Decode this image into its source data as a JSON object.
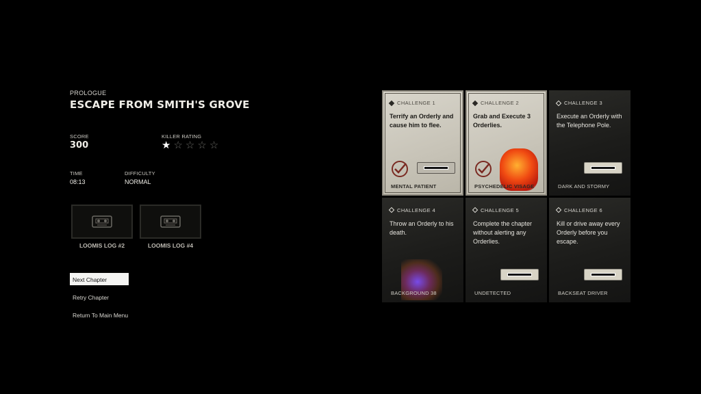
{
  "chapter": {
    "label": "PROLOGUE",
    "title": "ESCAPE FROM SMITH'S GROVE"
  },
  "stats": {
    "score_label": "SCORE",
    "score": "300",
    "rating_label": "KILLER RATING",
    "rating_value": 1,
    "rating_max": 5,
    "time_label": "TIME",
    "time": "08:13",
    "difficulty_label": "DIFFICULTY",
    "difficulty": "NORMAL"
  },
  "logs": [
    {
      "name": "LOOMIS LOG #2",
      "icon": "cassette-icon"
    },
    {
      "name": "LOOMIS LOG #4",
      "icon": "cassette-icon"
    }
  ],
  "menu": [
    {
      "label": "Next Chapter",
      "selected": true
    },
    {
      "label": "Retry Chapter",
      "selected": false
    },
    {
      "label": "Return To Main Menu",
      "selected": false
    }
  ],
  "challenges": [
    {
      "title": "CHALLENGE 1",
      "desc": "Terrify an Orderly and cause him to flee.",
      "reward": "MENTAL PATIENT",
      "completed": true
    },
    {
      "title": "CHALLENGE 2",
      "desc": "Grab and Execute 3 Orderlies.",
      "reward": "PSYCHEDELIC VISAGE",
      "completed": true
    },
    {
      "title": "CHALLENGE 3",
      "desc": "Execute an Orderly with the Telephone Pole.",
      "reward": "DARK AND STORMY",
      "completed": false
    },
    {
      "title": "CHALLENGE 4",
      "desc": "Throw an Orderly to his death.",
      "reward": "BACKGROUND 38",
      "completed": false
    },
    {
      "title": "CHALLENGE 5",
      "desc": "Complete the chapter without alerting any Orderlies.",
      "reward": "UNDETECTED",
      "completed": false
    },
    {
      "title": "CHALLENGE 6",
      "desc": "Kill or drive away every Orderly before you escape.",
      "reward": "BACKSEAT DRIVER",
      "completed": false
    }
  ],
  "colors": {
    "background": "#000000",
    "card_completed": "#d3d0c6",
    "card_locked": "#1f1f1d",
    "selected_menu": "#f4f4f2"
  }
}
